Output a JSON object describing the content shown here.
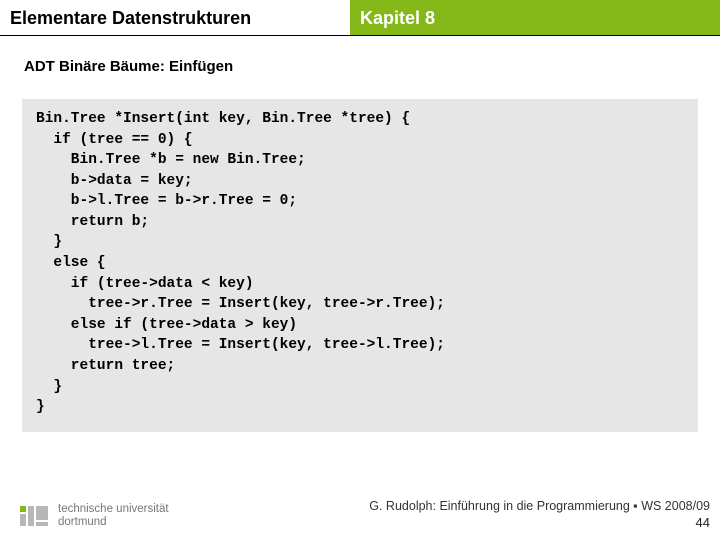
{
  "header": {
    "left": "Elementare Datenstrukturen",
    "right": "Kapitel 8"
  },
  "subtitle": "ADT Binäre Bäume: Einfügen",
  "code": "Bin.Tree *Insert(int key, Bin.Tree *tree) {\n  if (tree == 0) {\n    Bin.Tree *b = new Bin.Tree;\n    b->data = key;\n    b->l.Tree = b->r.Tree = 0;\n    return b;\n  }\n  else {\n    if (tree->data < key)\n      tree->r.Tree = Insert(key, tree->r.Tree);\n    else if (tree->data > key)\n      tree->l.Tree = Insert(key, tree->l.Tree);\n    return tree;\n  }\n}",
  "footer": {
    "uni_line1": "technische universität",
    "uni_line2": "dortmund",
    "credit": "G. Rudolph: Einführung in die Programmierung ▪ WS 2008/09",
    "slide": "44"
  },
  "colors": {
    "accent": "#84b818",
    "codebg": "#e6e6e6"
  }
}
